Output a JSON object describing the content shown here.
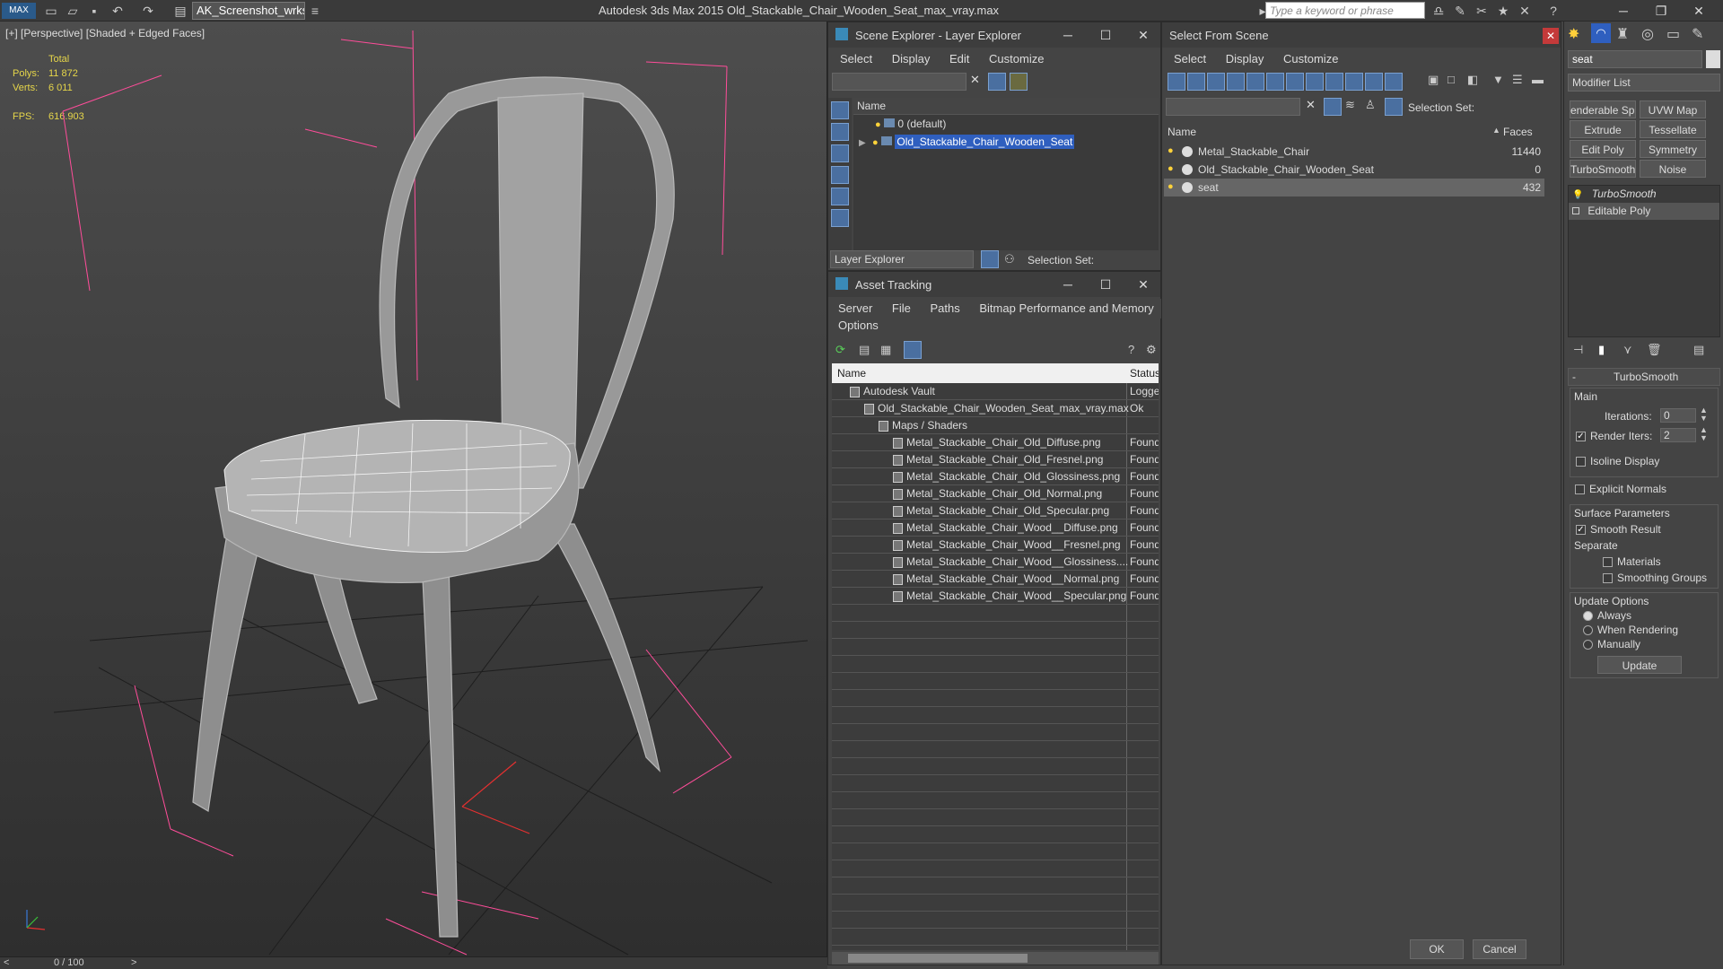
{
  "titlebar": {
    "workspace": "AK_Screenshot_wrksp",
    "app_title": "Autodesk 3ds Max  2015    Old_Stackable_Chair_Wooden_Seat_max_vray.max",
    "search_placeholder": "Type a keyword or phrase"
  },
  "viewport": {
    "label": "[+] [Perspective] [Shaded + Edged Faces]",
    "stats": {
      "total_label": "Total",
      "polys_label": "Polys:",
      "polys": "11 872",
      "verts_label": "Verts:",
      "verts": "6 011",
      "fps_label": "FPS:",
      "fps": "616.903"
    },
    "timeslider": "0 / 100"
  },
  "scene_explorer": {
    "title": "Scene Explorer - Layer Explorer",
    "menus": [
      "Select",
      "Display",
      "Edit",
      "Customize"
    ],
    "col_name": "Name",
    "layers": [
      "0 (default)",
      "Old_Stackable_Chair_Wooden_Seat"
    ],
    "footer_dd": "Layer Explorer",
    "selection_set": "Selection Set:"
  },
  "asset_tracking": {
    "title": "Asset Tracking",
    "menus": [
      "Server",
      "File",
      "Paths",
      "Bitmap Performance and Memory"
    ],
    "menus2": [
      "Options"
    ],
    "col_name": "Name",
    "col_status": "Status",
    "rows": [
      {
        "name": "Autodesk Vault",
        "status": "Logge",
        "indent": 0
      },
      {
        "name": "Old_Stackable_Chair_Wooden_Seat_max_vray.max",
        "status": "Ok",
        "indent": 1
      },
      {
        "name": "Maps / Shaders",
        "status": "",
        "indent": 2
      },
      {
        "name": "Metal_Stackable_Chair_Old_Diffuse.png",
        "status": "Found",
        "indent": 3
      },
      {
        "name": "Metal_Stackable_Chair_Old_Fresnel.png",
        "status": "Found",
        "indent": 3
      },
      {
        "name": "Metal_Stackable_Chair_Old_Glossiness.png",
        "status": "Found",
        "indent": 3
      },
      {
        "name": "Metal_Stackable_Chair_Old_Normal.png",
        "status": "Found",
        "indent": 3
      },
      {
        "name": "Metal_Stackable_Chair_Old_Specular.png",
        "status": "Found",
        "indent": 3
      },
      {
        "name": "Metal_Stackable_Chair_Wood__Diffuse.png",
        "status": "Found",
        "indent": 3
      },
      {
        "name": "Metal_Stackable_Chair_Wood__Fresnel.png",
        "status": "Found",
        "indent": 3
      },
      {
        "name": "Metal_Stackable_Chair_Wood__Glossiness....",
        "status": "Found",
        "indent": 3
      },
      {
        "name": "Metal_Stackable_Chair_Wood__Normal.png",
        "status": "Found",
        "indent": 3
      },
      {
        "name": "Metal_Stackable_Chair_Wood__Specular.png",
        "status": "Found",
        "indent": 3
      }
    ]
  },
  "select_from_scene": {
    "title": "Select From Scene",
    "menus": [
      "Select",
      "Display",
      "Customize"
    ],
    "selection_set": "Selection Set:",
    "col_name": "Name",
    "col_faces": "Faces",
    "rows": [
      {
        "name": "Metal_Stackable_Chair",
        "faces": "11440"
      },
      {
        "name": "Old_Stackable_Chair_Wooden_Seat",
        "faces": "0"
      },
      {
        "name": "seat",
        "faces": "432"
      }
    ],
    "ok": "OK",
    "cancel": "Cancel"
  },
  "command_panel": {
    "object_name": "seat",
    "modifier_list": "Modifier List",
    "buttons": [
      "enderable Splir",
      "UVW Map",
      "Extrude",
      "Tessellate",
      "Edit Poly",
      "Symmetry",
      "TurboSmooth",
      "Noise"
    ],
    "stack": [
      "TurboSmooth",
      "Editable Poly"
    ],
    "rollout_title": "TurboSmooth",
    "main": "Main",
    "iterations_label": "Iterations:",
    "iterations": "0",
    "render_iters_label": "Render Iters:",
    "render_iters": "2",
    "isoline": "Isoline Display",
    "explicit": "Explicit Normals",
    "surface": "Surface Parameters",
    "smooth": "Smooth Result",
    "separate": "Separate",
    "materials": "Materials",
    "smoothing": "Smoothing Groups",
    "update_options": "Update Options",
    "always": "Always",
    "when_rendering": "When Rendering",
    "manually": "Manually",
    "update": "Update"
  }
}
